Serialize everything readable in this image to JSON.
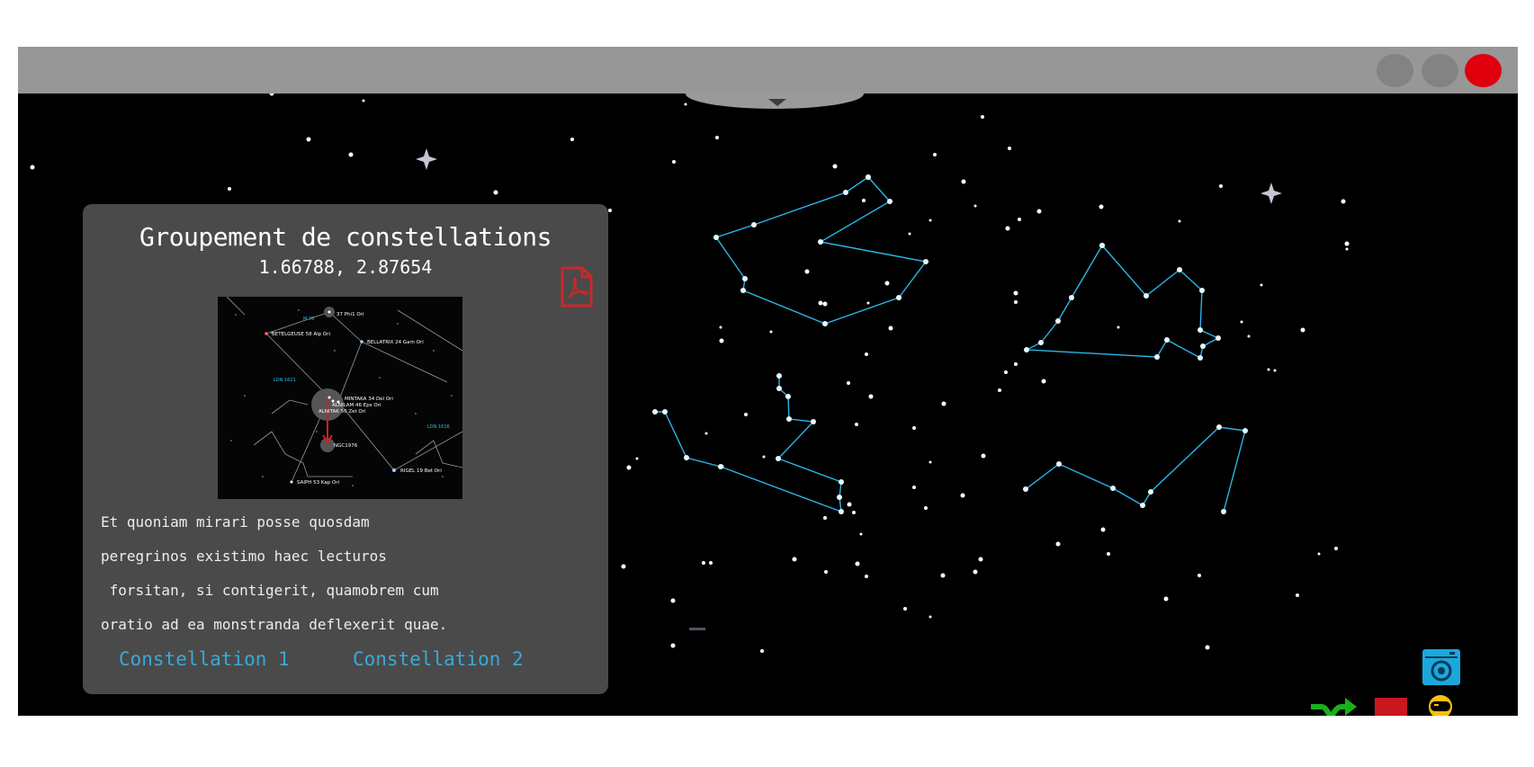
{
  "window": {
    "controls": [
      "minimize",
      "maximize",
      "close"
    ],
    "colors": {
      "titlebar": "#979797",
      "close": "#e0000d",
      "control": "#838383"
    }
  },
  "panel": {
    "title": "Groupement de constellations",
    "coords": "1.66788, 2.87654",
    "text_lines": [
      "Et quoniam mirari posse quosdam",
      "peregrinos existimo haec lecturos",
      " forsitan, si contigerit, quamobrem cum",
      "oratio ad ea monstranda deflexerit quae."
    ],
    "links": [
      "Constellation 1",
      "Constellation 2"
    ],
    "pdf_icon": "pdf-file-icon",
    "chart_labels": {
      "betelgeuse": "BETELGEUSE 58 Alp Ori",
      "bellatrix": "BELLATRIX 24 Gam Ori",
      "mintaka": "MINTAKA 34 Del Ori",
      "alnilam": "ALNILAM 46 Eps Ori",
      "alnitak": "ALNITAK 50 Zet Ori",
      "rigel": "RIGEL 19 Bet Ori",
      "saiph": "SAIPH 53 Kap Ori",
      "pi1": "37 Phi1 Ori",
      "ngc": "NGC1976",
      "ldn1": "LDN 1621",
      "ldn2": "LDN 1616",
      "m": "M 78"
    }
  },
  "toolbar": {
    "icons": [
      "camera-icon",
      "shuffle-icon",
      "bookmark-icon",
      "astronaut-icon"
    ],
    "colors": {
      "camera": "#1aa8dc",
      "shuffle": "#19b01b",
      "bookmark": "#c8181d",
      "astronaut": "#f3c20c"
    }
  },
  "colors": {
    "constellation_lines": "#29b6e8",
    "panel": "#4a4a4a",
    "link": "#3aa9d8",
    "sky": "#000000"
  }
}
